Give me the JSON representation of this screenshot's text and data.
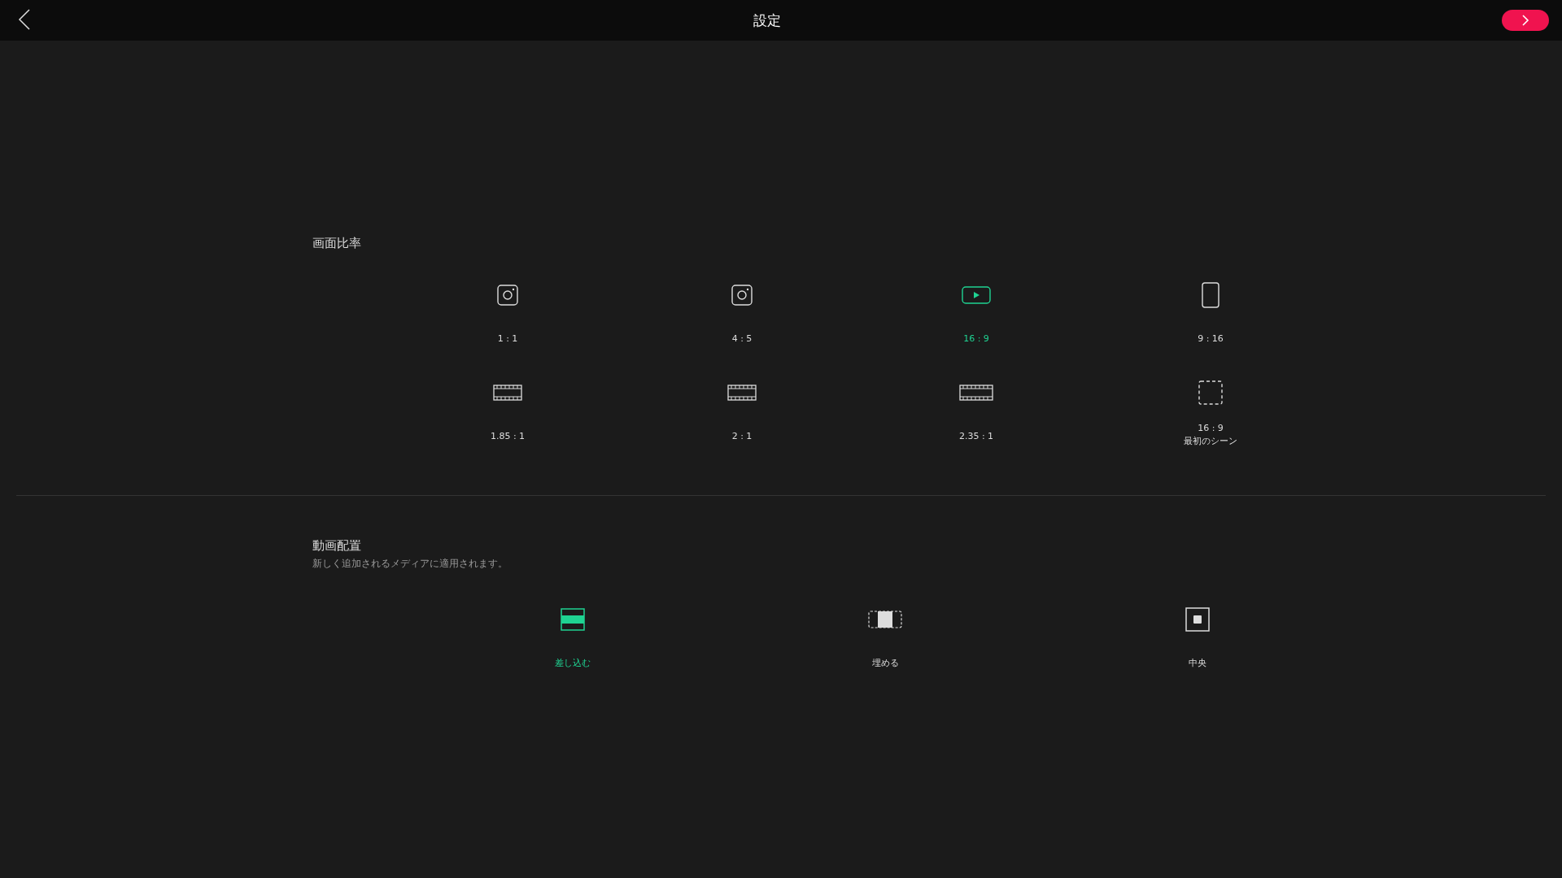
{
  "header": {
    "title": "設定"
  },
  "aspect_ratio": {
    "title": "画面比率",
    "options": [
      {
        "kind": "square",
        "label": "1 : 1",
        "selected": false
      },
      {
        "kind": "square",
        "label": "4 : 5",
        "selected": false
      },
      {
        "kind": "play",
        "label": "16 : 9",
        "selected": true
      },
      {
        "kind": "portrait",
        "label": "9 : 16",
        "selected": false
      },
      {
        "kind": "film",
        "label": "1.85 : 1",
        "selected": false
      },
      {
        "kind": "film",
        "label": "2 : 1",
        "selected": false
      },
      {
        "kind": "widefilm",
        "label": "2.35 : 1",
        "selected": false
      },
      {
        "kind": "dashed",
        "label": "16 : 9",
        "sublabel": "最初のシーン",
        "selected": false
      }
    ]
  },
  "placement": {
    "title": "動画配置",
    "subtitle": "新しく追加されるメディアに適用されます。",
    "options": [
      {
        "kind": "letterbox",
        "label": "差し込む",
        "selected": true
      },
      {
        "kind": "fill",
        "label": "埋める",
        "selected": false
      },
      {
        "kind": "center",
        "label": "中央",
        "selected": false
      }
    ]
  }
}
